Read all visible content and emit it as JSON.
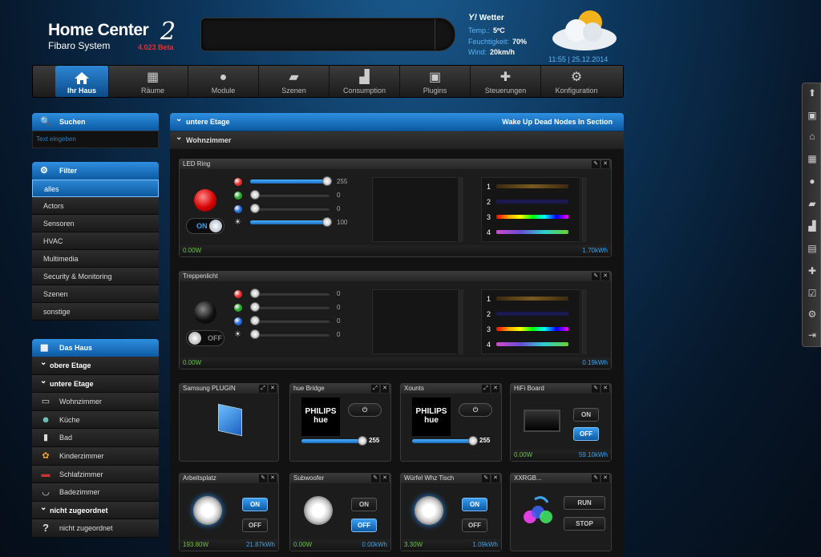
{
  "header": {
    "logo_title": "Home Center",
    "logo_number": "2",
    "logo_subtitle": "Fibaro System",
    "version": "4.023 Beta"
  },
  "weather": {
    "label": "Wetter",
    "temp_label": "Temp.:",
    "temp_value": "5ºC",
    "humidity_label": "Feuchtigkeit:",
    "humidity_value": "70%",
    "wind_label": "Wind:",
    "wind_value": "20km/h",
    "clock": "11:55 | 25.12.2014"
  },
  "nav": [
    {
      "label": "Ihr Haus",
      "icon": "home-icon"
    },
    {
      "label": "Räume",
      "icon": "rooms-icon"
    },
    {
      "label": "Module",
      "icon": "bulb-icon"
    },
    {
      "label": "Szenen",
      "icon": "clapper-icon"
    },
    {
      "label": "Consumption",
      "icon": "chart-icon"
    },
    {
      "label": "Plugins",
      "icon": "plugin-icon"
    },
    {
      "label": "Steuerungen",
      "icon": "puzzle-icon"
    },
    {
      "label": "Konfiguration",
      "icon": "gears-icon"
    }
  ],
  "search": {
    "title": "Suchen",
    "placeholder": "Text eingeben"
  },
  "filter": {
    "title": "Filter",
    "items": [
      "alles",
      "Actors",
      "Sensoren",
      "HVAC",
      "Multimedia",
      "Security & Monitoring",
      "Szenen",
      "sonstige"
    ]
  },
  "house": {
    "title": "Das Haus",
    "sections": [
      "obere Etage",
      "untere Etage"
    ],
    "rooms": [
      {
        "label": "Wohnzimmer",
        "icon": "tv-icon"
      },
      {
        "label": "Küche",
        "icon": "chef-icon"
      },
      {
        "label": "Bad",
        "icon": "bath-icon"
      },
      {
        "label": "Kinderzimmer",
        "icon": "kids-icon"
      },
      {
        "label": "Schlafzimmer",
        "icon": "bed-icon"
      },
      {
        "label": "Badezimmer",
        "icon": "tub-icon"
      }
    ],
    "unassigned_section": "nicht zugeordnet",
    "unassigned_item": "nicht zugeordnet"
  },
  "main": {
    "section_title": "untere Etage",
    "action_link": "Wake Up Dead Nodes In Section",
    "room_title": "Wohnzimmer"
  },
  "led_ring": {
    "title": "LED Ring",
    "toggle": "ON",
    "sliders": [
      {
        "color": "#e32b2b",
        "value": "255",
        "fill": 1.0
      },
      {
        "color": "#29a52d",
        "value": "0",
        "fill": 0.0
      },
      {
        "color": "#2367d8",
        "value": "0",
        "fill": 0.0
      },
      {
        "color": "#dddddd",
        "value": "100",
        "fill": 1.0
      }
    ],
    "programs": [
      "1",
      "2",
      "3",
      "4"
    ],
    "power": "0.00W",
    "energy": "1.70kWh"
  },
  "treppenlicht": {
    "title": "Treppenlicht",
    "toggle": "OFF",
    "sliders": [
      {
        "color": "#e32b2b",
        "value": "0",
        "fill": 0.0
      },
      {
        "color": "#29a52d",
        "value": "0",
        "fill": 0.0
      },
      {
        "color": "#2367d8",
        "value": "0",
        "fill": 0.0
      },
      {
        "color": "#dddddd",
        "value": "0",
        "fill": 0.0
      }
    ],
    "programs": [
      "1",
      "2",
      "3",
      "4"
    ],
    "power": "0.00W",
    "energy": "0.19kWh"
  },
  "samsung": {
    "title": "Samsung PLUGIN"
  },
  "hue_bridge": {
    "title": "hue Bridge",
    "logo1": "PHILIPS",
    "logo2": "hue",
    "value": "255"
  },
  "xounts": {
    "title": "Xounts",
    "logo1": "PHILIPS",
    "logo2": "hue",
    "value": "255"
  },
  "hifi": {
    "title": "HiFi Board",
    "on": "ON",
    "off": "OFF",
    "power": "0.00W",
    "energy": "59.10kWh"
  },
  "arbeitsplatz": {
    "title": "Arbeitsplatz",
    "on": "ON",
    "off": "OFF",
    "power": "193.80W",
    "energy": "21.87kWh"
  },
  "subwoofer": {
    "title": "Subwoofer",
    "on": "ON",
    "off": "OFF",
    "power": "0.00W",
    "energy": "0.00kWh"
  },
  "wuerfel": {
    "title": "Würfel Whz Tisch",
    "on": "ON",
    "off": "OFF",
    "power": "3.30W",
    "energy": "1.09kWh"
  },
  "xxrgb": {
    "title": "XXRGB...",
    "run": "RUN",
    "stop": "STOP"
  },
  "colors": {
    "accent": "#1a78cc",
    "power_green": "#6bc346",
    "energy_blue": "#3ea3ee"
  }
}
